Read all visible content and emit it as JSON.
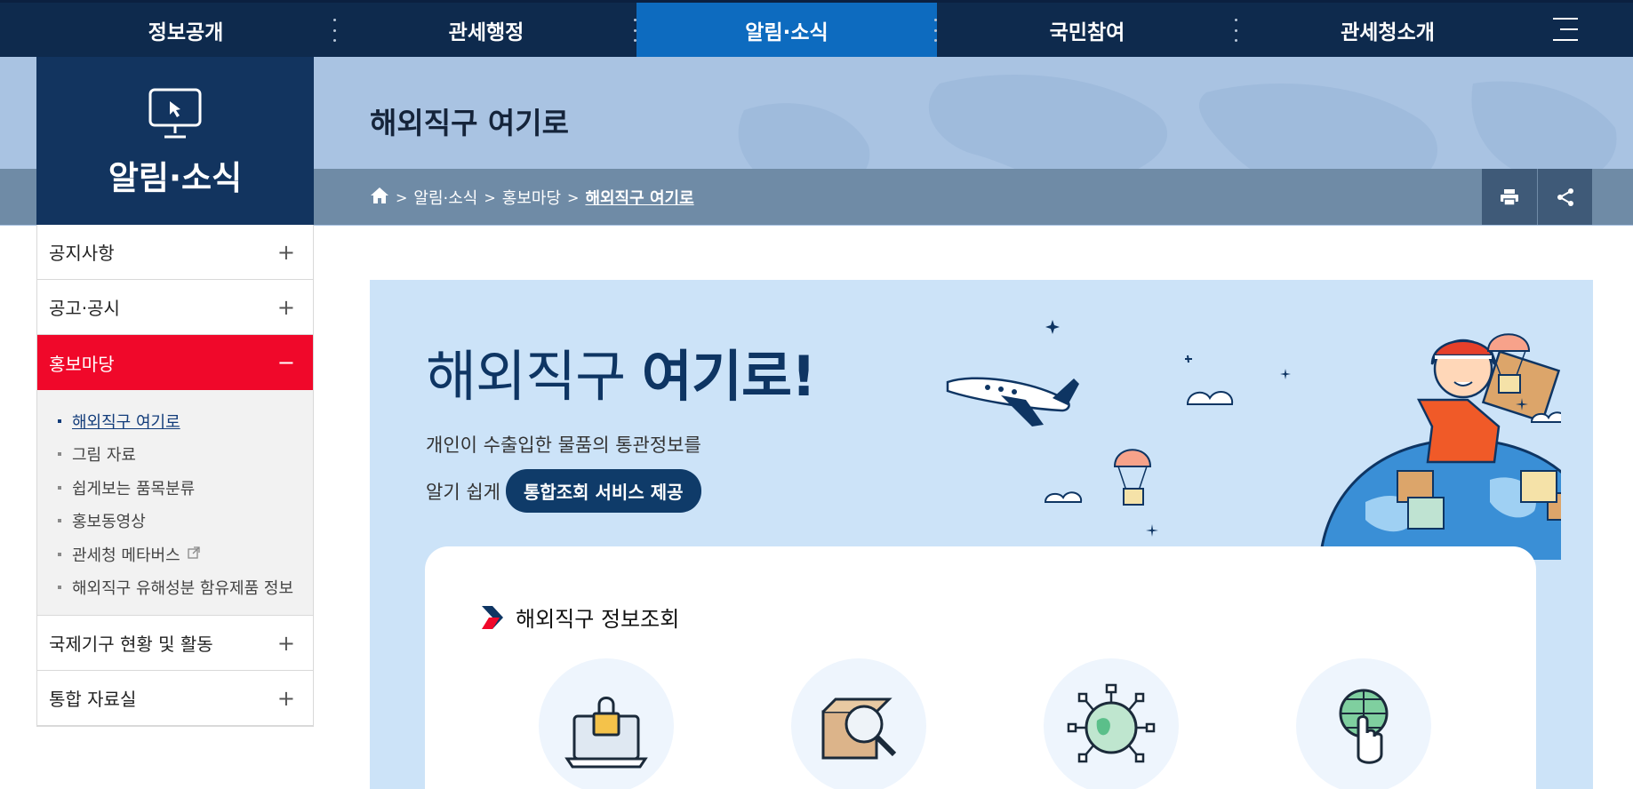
{
  "topnav": {
    "items": [
      "정보공개",
      "관세행정",
      "알림·소식",
      "국민참여",
      "관세청소개"
    ],
    "active_index": 2,
    "menu_icon": "hamburger-icon"
  },
  "sidebar": {
    "category_title": "알림·소식",
    "category_icon": "monitor-cursor-icon",
    "menu": [
      {
        "label": "공지사항",
        "toggle": "+"
      },
      {
        "label": "공고·공시",
        "toggle": "+"
      },
      {
        "label": "홍보마당",
        "toggle": "−"
      },
      {
        "label": "국제기구 현황 및 활동",
        "toggle": "+"
      },
      {
        "label": "통합 자료실",
        "toggle": "+"
      }
    ],
    "submenu": [
      {
        "label": "해외직구 여기로"
      },
      {
        "label": "그림 자료"
      },
      {
        "label": "쉽게보는 품목분류"
      },
      {
        "label": "홍보동영상"
      },
      {
        "label": "관세청 메타버스"
      },
      {
        "label": "해외직구 유해성분 함유제품 정보"
      }
    ]
  },
  "header": {
    "title": "해외직구 여기로",
    "breadcrumb": [
      "알림·소식",
      "홍보마당",
      "해외직구 여기로"
    ],
    "tools": [
      "print-icon",
      "share-icon"
    ]
  },
  "hero": {
    "title_light": "해외직구 ",
    "title_bold": "여기로!",
    "desc_line1": "개인이 수출입한 물품의 통관정보를",
    "desc_line2": "알기 쉽게",
    "pill": "통합조회 서비스 제공"
  },
  "card": {
    "title": "해외직구 정보조회",
    "services": [
      "laptop-lock-icon",
      "box-search-icon",
      "globe-network-icon",
      "globe-touch-icon"
    ]
  },
  "colors": {
    "nav_bg": "#0e2a4d",
    "nav_active": "#0d6bbf",
    "menu_active": "#f0082a",
    "hero_bg": "#cce3f8",
    "title_dark": "#0e3563"
  }
}
